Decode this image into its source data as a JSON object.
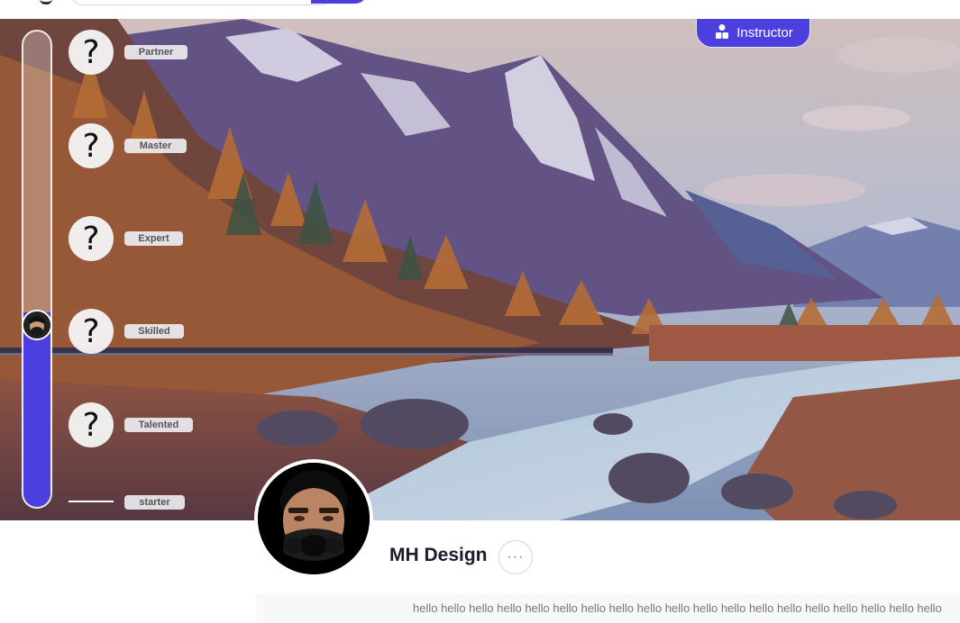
{
  "profile": {
    "name": "MH Design",
    "role_badge": "Instructor",
    "bio": "hello hello hello hello hello hello hello hello hello hello hello hello hello hello hello hello hello hello hello"
  },
  "levels": [
    {
      "label": "Partner",
      "badge": "?"
    },
    {
      "label": "Master",
      "badge": "?"
    },
    {
      "label": "Expert",
      "badge": "?"
    },
    {
      "label": "Skilled",
      "badge": "?"
    },
    {
      "label": "Talented",
      "badge": "?"
    },
    {
      "label": "starter"
    }
  ],
  "level_progress": 0.41,
  "more_button": "···",
  "colors": {
    "accent": "#4b3fe0",
    "page_background": "#ffffff",
    "bio_background": "#f7f8fa"
  },
  "icons": {
    "instructor": "user-group-icon",
    "more": "ellipsis-icon",
    "level_locked": "question-mark-icon"
  }
}
